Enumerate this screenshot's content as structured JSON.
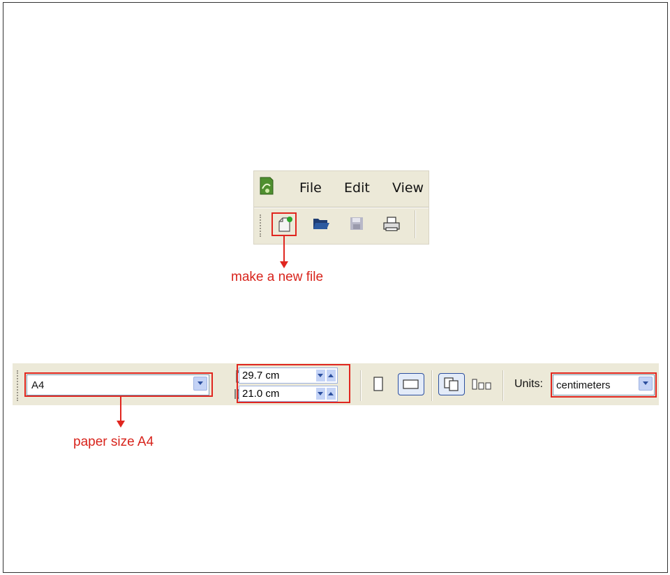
{
  "menu": {
    "file": "File",
    "edit": "Edit",
    "view": "View"
  },
  "toolbar": {
    "buttons": [
      {
        "name": "new-file",
        "icon": "new-document-icon"
      },
      {
        "name": "open",
        "icon": "open-folder-icon"
      },
      {
        "name": "save",
        "icon": "save-disk-icon"
      },
      {
        "name": "print",
        "icon": "printer-icon"
      }
    ]
  },
  "annotations": {
    "new_file": "make a new file",
    "paper_size": "paper size A4"
  },
  "property_bar": {
    "paper_size": "A4",
    "width_value": "29.7 cm",
    "height_value": "21.0 cm",
    "units_label": "Units:",
    "units_value": "centimeters"
  },
  "colors": {
    "highlight": "#e0261f",
    "toolbar_bg": "#ece9d8",
    "accent": "#2c4f9e"
  }
}
